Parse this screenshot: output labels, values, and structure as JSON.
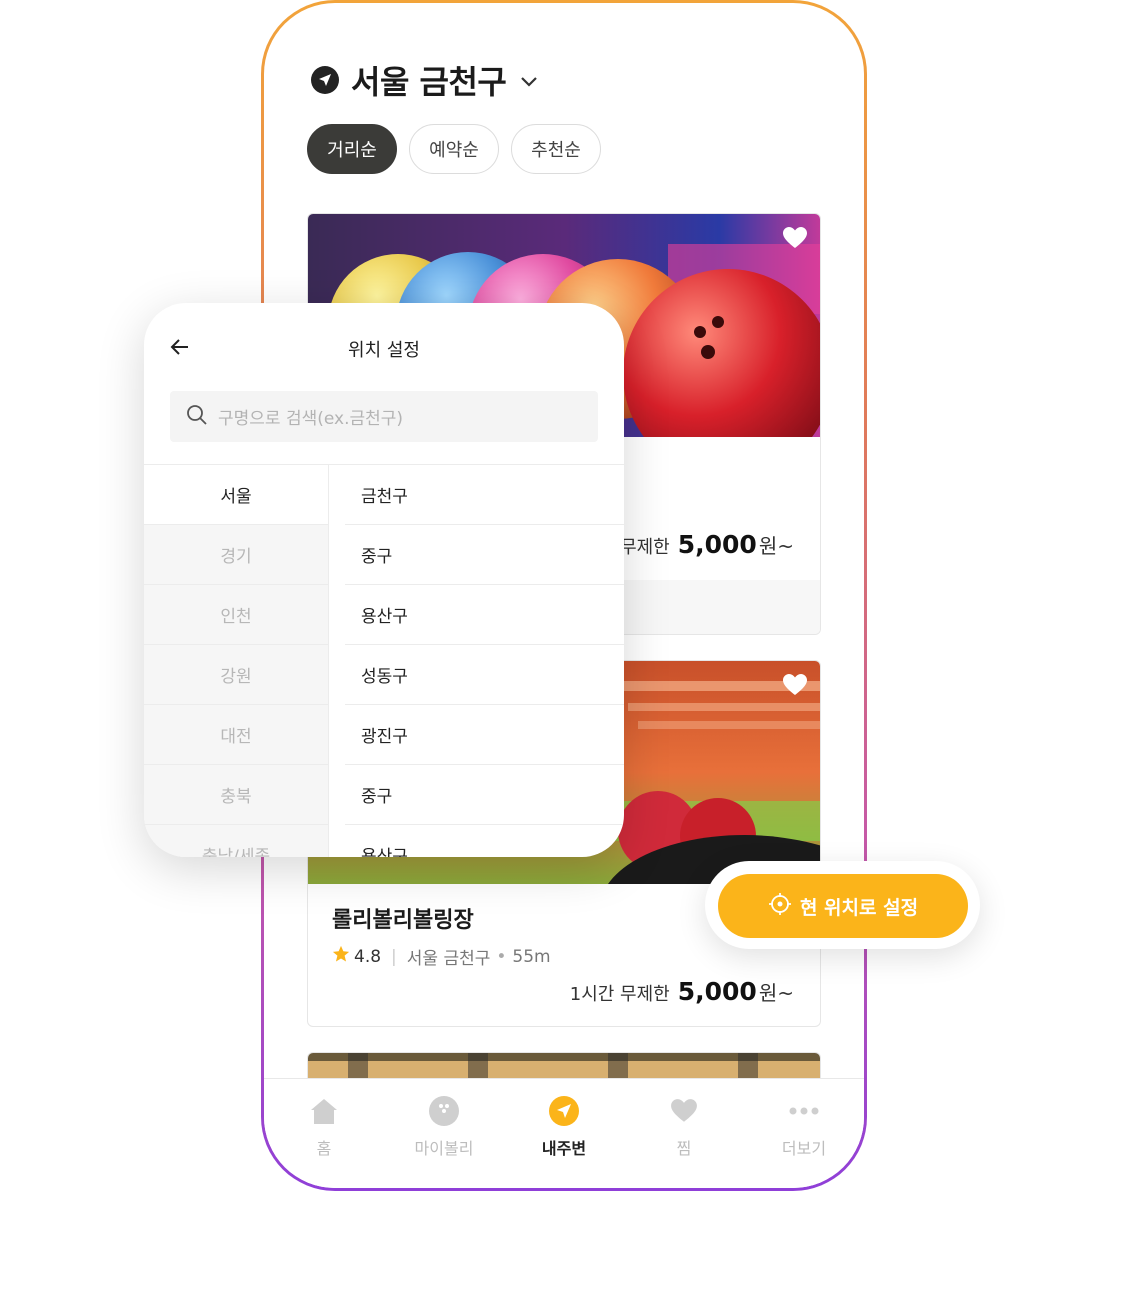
{
  "header": {
    "location_title": "서울 금천구"
  },
  "sort_tabs": [
    {
      "label": "거리순",
      "active": true
    },
    {
      "label": "예약순",
      "active": false
    },
    {
      "label": "추천순",
      "active": false
    }
  ],
  "cards": [
    {
      "price_prefix": "간 무제한",
      "price": "5,000",
      "price_unit": "원~"
    },
    {
      "name": "롤리볼리볼링장",
      "rating": "4.8",
      "region": "서울 금천구",
      "distance": "55m",
      "price_prefix": "1시간 무제한",
      "price": "5,000",
      "price_unit": "원~"
    }
  ],
  "modal": {
    "title": "위치 설정",
    "search_placeholder": "구명으로 검색(ex.금천구)",
    "regions": [
      "서울",
      "경기",
      "인천",
      "강원",
      "대전",
      "충북",
      "충남/세종"
    ],
    "districts": [
      "금천구",
      "중구",
      "용산구",
      "성동구",
      "광진구",
      "중구",
      "용산구"
    ]
  },
  "float_button": {
    "label": "현 위치로 설정"
  },
  "bottom_nav": [
    {
      "label": "홈",
      "icon": "home-icon"
    },
    {
      "label": "마이볼리",
      "icon": "bowling-ball-icon"
    },
    {
      "label": "내주변",
      "icon": "location-arrow-icon",
      "active": true
    },
    {
      "label": "찜",
      "icon": "heart-icon"
    },
    {
      "label": "더보기",
      "icon": "more-dots-icon"
    }
  ],
  "colors": {
    "accent": "#fbb41a",
    "active_tab": "#3b3b38"
  }
}
